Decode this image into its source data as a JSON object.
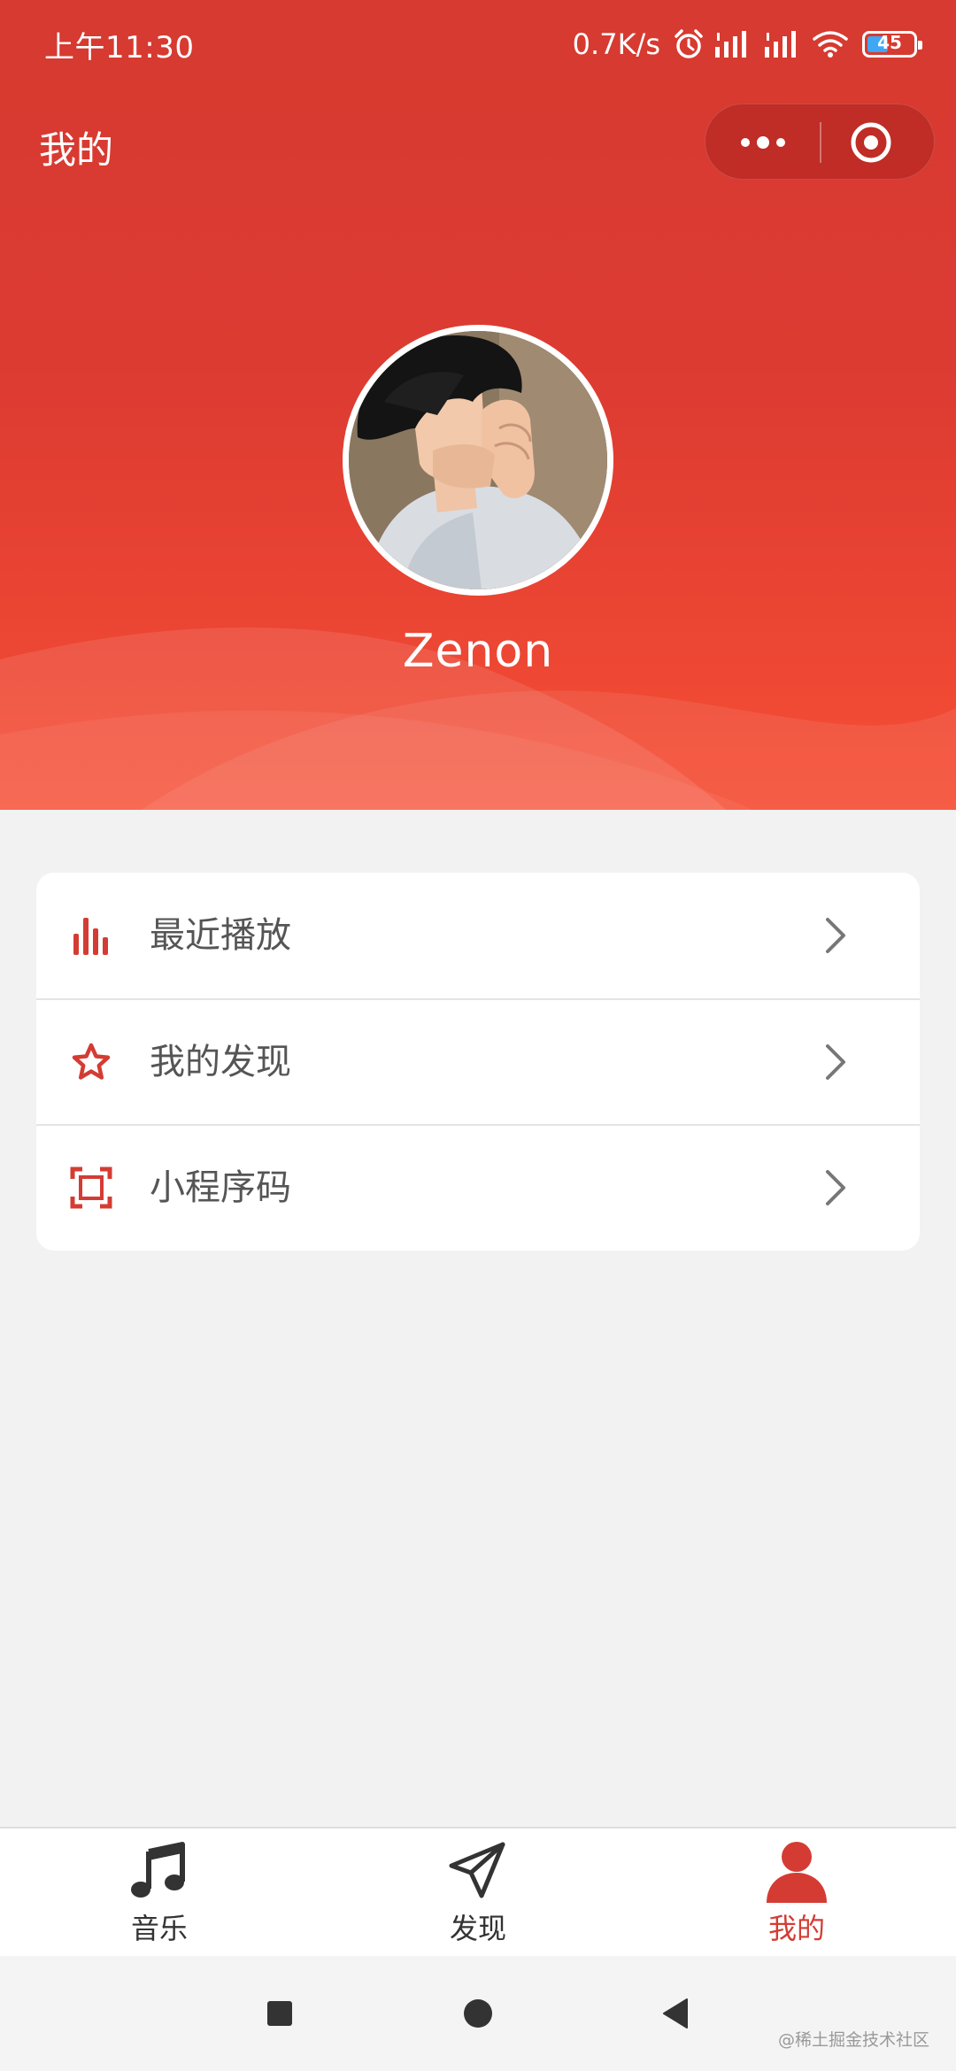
{
  "status_bar": {
    "time": "上午11:30",
    "network_speed": "0.7K/s",
    "battery_level": "45",
    "battery_fraction": 0.45,
    "battery_color": "#3fa7f4"
  },
  "nav": {
    "title": "我的",
    "more_icon": "more-dots-icon",
    "close_icon": "target-circle-icon"
  },
  "profile": {
    "username": "Zenon",
    "avatar_icon": "anime-boy-avatar"
  },
  "menu": {
    "items": [
      {
        "label": "最近播放",
        "icon": "bar-chart-icon"
      },
      {
        "label": "我的发现",
        "icon": "star-outline-icon"
      },
      {
        "label": "小程序码",
        "icon": "scan-frame-icon"
      }
    ]
  },
  "tabbar": {
    "items": [
      {
        "label": "音乐",
        "icon": "music-note-icon",
        "active": false
      },
      {
        "label": "发现",
        "icon": "paper-plane-icon",
        "active": false
      },
      {
        "label": "我的",
        "icon": "person-icon",
        "active": true
      }
    ]
  },
  "system_nav": {
    "watermark": "@稀土掘金技术社区"
  },
  "colors": {
    "brand_red": "#d43c33",
    "header_top": "#d63a30",
    "header_bottom": "#f65036",
    "background": "#f2f2f2",
    "text_gray": "#555555",
    "tab_inactive": "#333333"
  }
}
